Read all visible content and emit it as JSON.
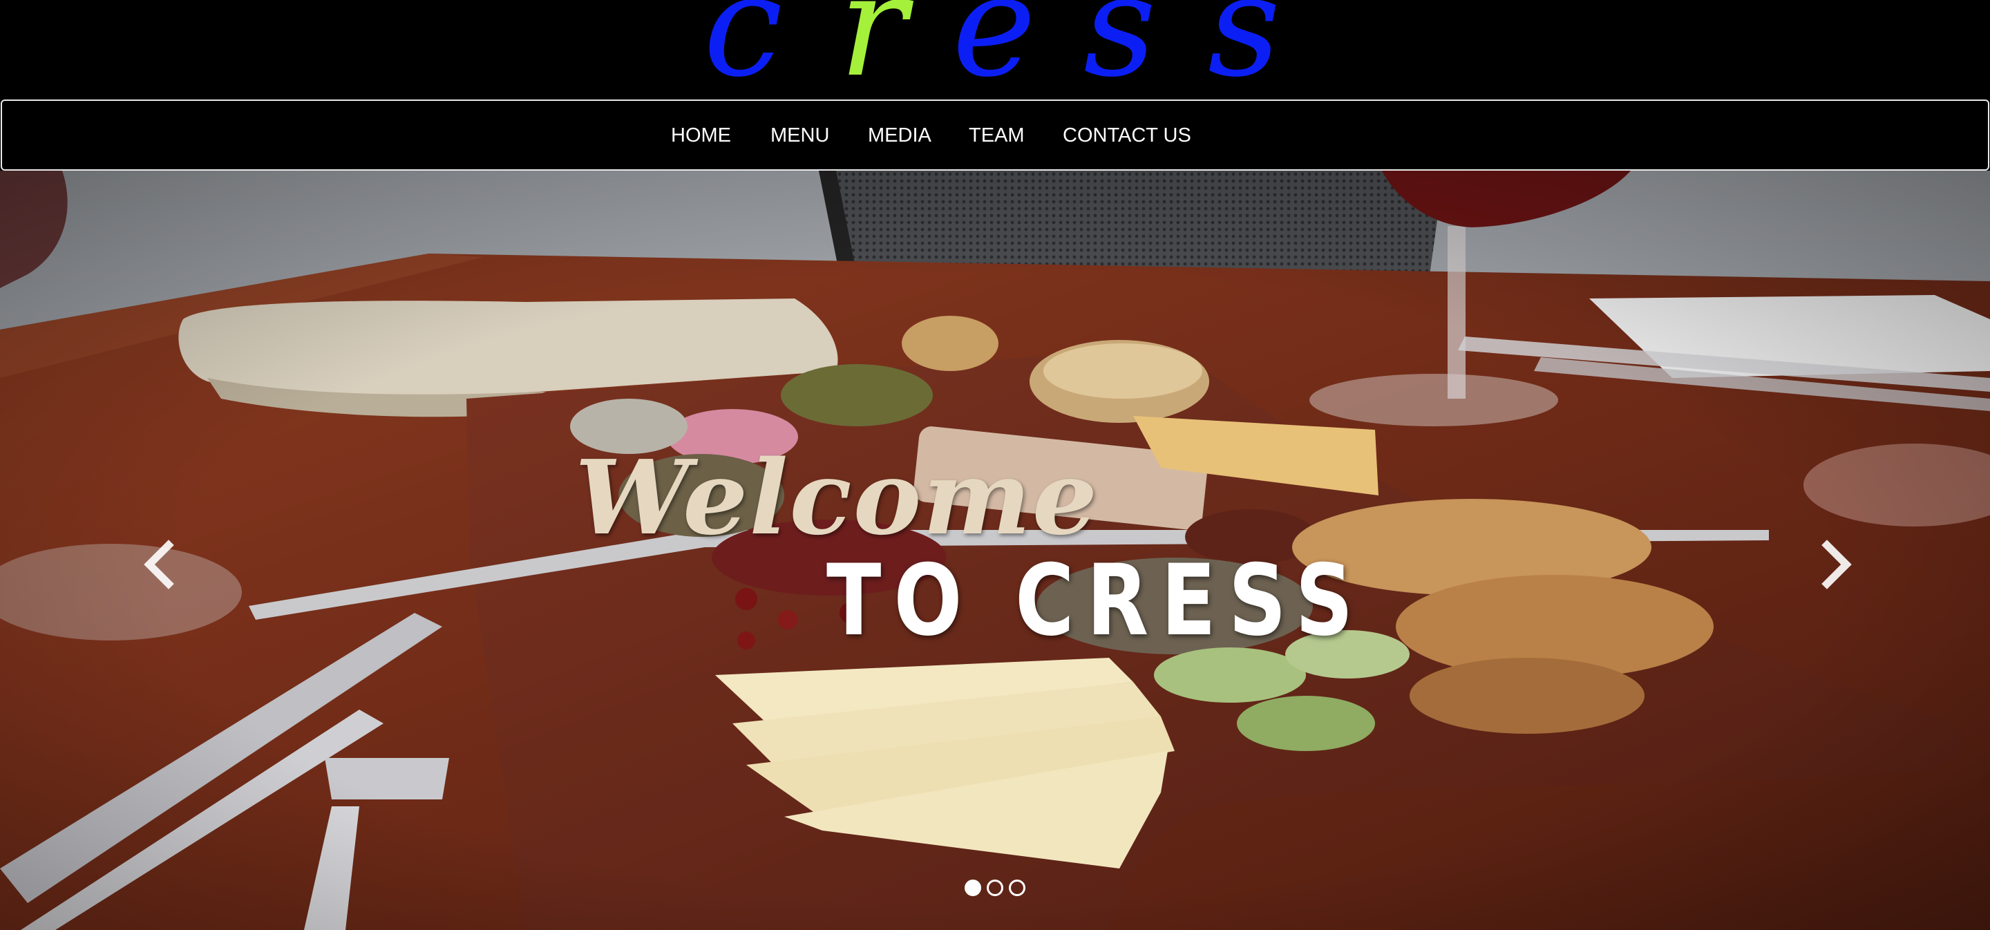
{
  "logo": {
    "letters": [
      {
        "char": "c",
        "color": "#0b1ff5"
      },
      {
        "char": "r",
        "color": "#a4f03b"
      },
      {
        "char": "e",
        "color": "#0b1ff5"
      },
      {
        "char": "s",
        "color": "#0b1ff5"
      },
      {
        "char": "s",
        "color": "#0b1ff5"
      }
    ]
  },
  "nav": {
    "items": [
      {
        "label": "HOME"
      },
      {
        "label": "MENU"
      },
      {
        "label": "MEDIA"
      },
      {
        "label": "TEAM"
      },
      {
        "label": "CONTACT US"
      }
    ]
  },
  "carousel": {
    "caption_line1": "Welcome",
    "caption_line2": "TO CRESS",
    "prev_icon": "chevron-left-icon",
    "next_icon": "chevron-right-icon",
    "slide_count": 3,
    "active_slide": 1
  },
  "colors": {
    "background": "#000000",
    "nav_text": "#ffffff",
    "nav_border": "#e9e9e9",
    "logo_blue": "#0b1ff5",
    "logo_green": "#a4f03b"
  }
}
